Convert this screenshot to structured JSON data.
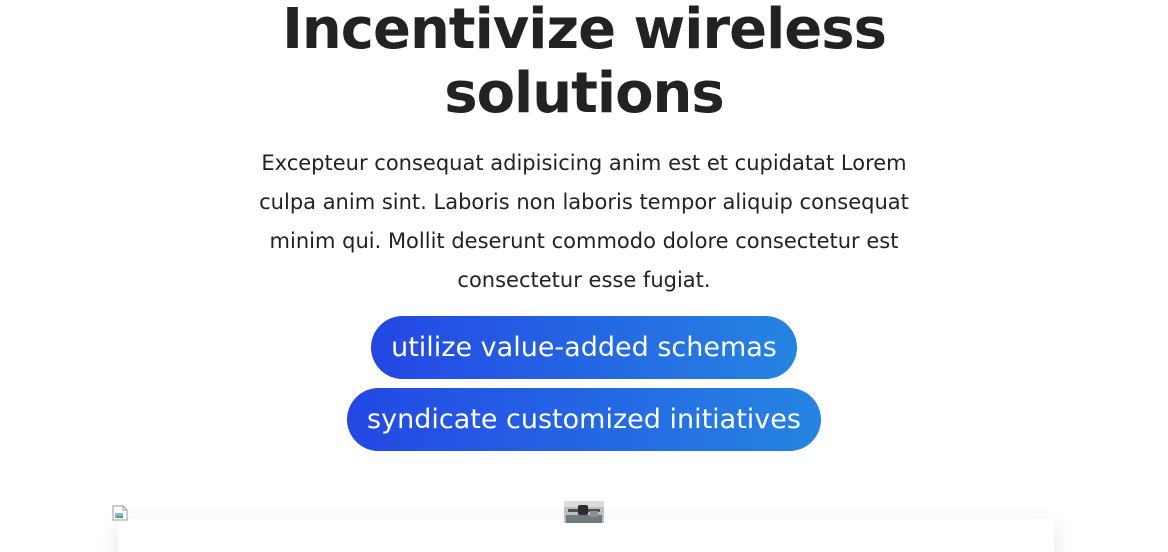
{
  "hero": {
    "title_line1": "Incentivize wireless",
    "title_line2": "solutions",
    "description": "Excepteur consequat adipisicing anim est et cupidatat Lorem culpa anim sint. Laboris non laboris tempor aliquip consequat minim qui. Mollit deserunt commodo dolore consectetur est consectetur esse fugiat."
  },
  "buttons": {
    "primary_label": "utilize value-added schemas",
    "secondary_label": "syndicate customized initiatives"
  },
  "colors": {
    "gradient_start": "#2447e4",
    "gradient_end": "#2584e2",
    "text": "#222222",
    "background": "#ffffff"
  },
  "icons": {
    "broken_image": "broken-image-icon"
  }
}
